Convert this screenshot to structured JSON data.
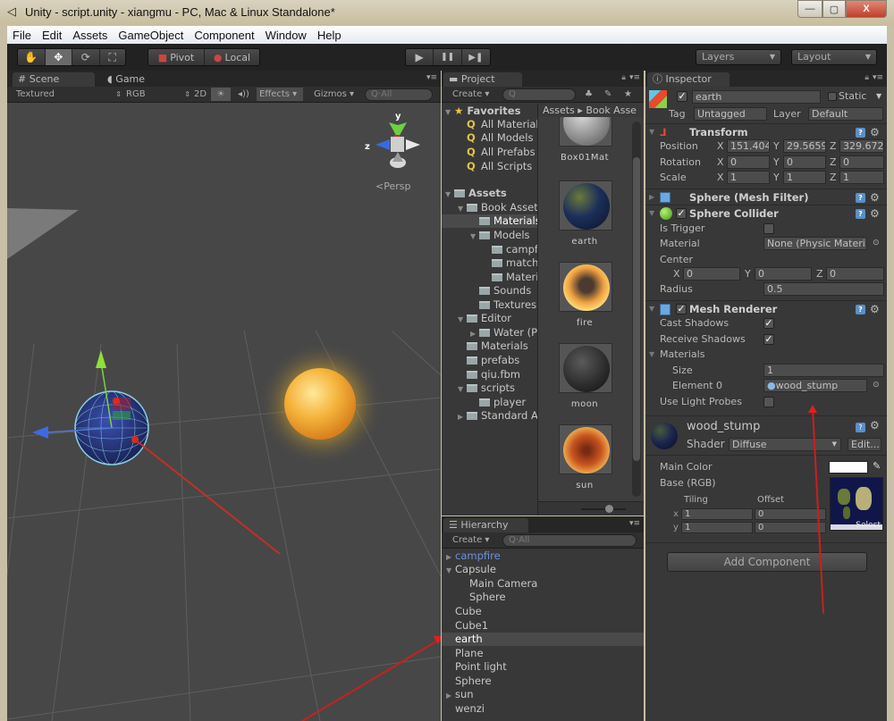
{
  "window": {
    "title": "Unity - script.unity - xiangmu - PC, Mac & Linux Standalone*",
    "controls": {
      "minimize": "—",
      "maximize": "▢",
      "close": "X"
    }
  },
  "menu": [
    "File",
    "Edit",
    "Assets",
    "GameObject",
    "Component",
    "Window",
    "Help"
  ],
  "toolbar": {
    "transform_tools": [
      {
        "name": "hand-tool",
        "glyph": "✋"
      },
      {
        "name": "move-tool",
        "glyph": "✥"
      },
      {
        "name": "rotate-tool",
        "glyph": "⟳"
      },
      {
        "name": "scale-tool",
        "glyph": "⛶"
      }
    ],
    "pivot_label": "Pivot",
    "local_label": "Local",
    "play_glyph": "▶",
    "pause_glyph": "❚❚",
    "step_glyph": "▶❚",
    "layers_label": "Layers",
    "layout_label": "Layout"
  },
  "scene_panel": {
    "tabs": [
      "Scene",
      "Game"
    ],
    "render_mode": "Textured",
    "color_mode": "RGB",
    "btn_2d": "2D",
    "effects_label": "Effects",
    "gizmos_label": "Gizmos",
    "search_placeholder": "All",
    "gizmo_y": "y",
    "gizmo_z": "z",
    "persp_label": "Persp"
  },
  "project_panel": {
    "tab": "Project",
    "create_label": "Create",
    "breadcrumb": "Assets ▸ Book Asse",
    "favorites_label": "Favorites",
    "favorites": [
      "All Material",
      "All Models",
      "All Prefabs",
      "All Scripts"
    ],
    "assets_label": "Assets",
    "tree": [
      {
        "label": "Book Asset",
        "depth": 1,
        "expanded": true
      },
      {
        "label": "Materials",
        "depth": 2,
        "selected": true
      },
      {
        "label": "Models",
        "depth": 2,
        "expanded": true
      },
      {
        "label": "campf",
        "depth": 3
      },
      {
        "label": "match",
        "depth": 3
      },
      {
        "label": "Materi",
        "depth": 3
      },
      {
        "label": "Sounds",
        "depth": 2
      },
      {
        "label": "Textures",
        "depth": 2
      },
      {
        "label": "Editor",
        "depth": 1,
        "expanded": true
      },
      {
        "label": "Water (P",
        "depth": 2,
        "collapsed": true
      },
      {
        "label": "Materials",
        "depth": 1
      },
      {
        "label": "prefabs",
        "depth": 1
      },
      {
        "label": "qiu.fbm",
        "depth": 1
      },
      {
        "label": "scripts",
        "depth": 1,
        "expanded": true
      },
      {
        "label": "player",
        "depth": 2
      },
      {
        "label": "Standard A",
        "depth": 1,
        "collapsed": true
      }
    ],
    "materials": [
      {
        "label": "Box01Mat",
        "color": "#9a9a9a"
      },
      {
        "label": "earth",
        "color": "#1c2f5a"
      },
      {
        "label": "fire",
        "color": "#e8902a"
      },
      {
        "label": "moon",
        "color": "#2a2a2a"
      },
      {
        "label": "sun",
        "color": "#c8541e"
      }
    ]
  },
  "hierarchy_panel": {
    "tab": "Hierarchy",
    "create_label": "Create",
    "search_placeholder": "All",
    "items": [
      {
        "label": "campfire",
        "depth": 0,
        "arrow": "▶",
        "prefab": true
      },
      {
        "label": "Capsule",
        "depth": 0,
        "arrow": "▼"
      },
      {
        "label": "Main Camera",
        "depth": 1
      },
      {
        "label": "Sphere",
        "depth": 1
      },
      {
        "label": "Cube",
        "depth": 0
      },
      {
        "label": "Cube1",
        "depth": 0
      },
      {
        "label": "earth",
        "depth": 0,
        "selected": true
      },
      {
        "label": "Plane",
        "depth": 0
      },
      {
        "label": "Point light",
        "depth": 0
      },
      {
        "label": "Sphere",
        "depth": 0
      },
      {
        "label": "sun",
        "depth": 0,
        "arrow": "▶"
      },
      {
        "label": "wenzi",
        "depth": 0
      }
    ]
  },
  "inspector": {
    "tab": "Inspector",
    "object_name": "earth",
    "active": true,
    "static_label": "Static",
    "tag_label": "Tag",
    "tag_value": "Untagged",
    "layer_label": "Layer",
    "layer_value": "Default",
    "transform": {
      "title": "Transform",
      "position": {
        "label": "Position",
        "x": "151.404",
        "y": "29.5659",
        "z": "329.672"
      },
      "rotation": {
        "label": "Rotation",
        "x": "0",
        "y": "0",
        "z": "0"
      },
      "scale": {
        "label": "Scale",
        "x": "1",
        "y": "1",
        "z": "1"
      }
    },
    "mesh_filter": {
      "title": "Sphere (Mesh Filter)"
    },
    "sphere_collider": {
      "title": "Sphere Collider",
      "is_trigger_label": "Is Trigger",
      "is_trigger": false,
      "material_label": "Material",
      "material_value": "None (Physic Materi",
      "center_label": "Center",
      "center": {
        "x": "0",
        "y": "0",
        "z": "0"
      },
      "radius_label": "Radius",
      "radius_value": "0.5"
    },
    "mesh_renderer": {
      "title": "Mesh Renderer",
      "cast_shadows_label": "Cast Shadows",
      "cast_shadows": true,
      "receive_shadows_label": "Receive Shadows",
      "receive_shadows": true,
      "materials_label": "Materials",
      "size_label": "Size",
      "size_value": "1",
      "element0_label": "Element 0",
      "element0_value": "wood_stump",
      "light_probes_label": "Use Light Probes",
      "light_probes": false
    },
    "material": {
      "name": "wood_stump",
      "shader_label": "Shader",
      "shader_value": "Diffuse",
      "edit_label": "Edit...",
      "main_color_label": "Main Color",
      "main_color": "#ffffff",
      "base_label": "Base (RGB)",
      "tiling_label": "Tiling",
      "offset_label": "Offset",
      "x_label": "x",
      "y_label": "y",
      "tiling_x": "1",
      "tiling_y": "1",
      "offset_x": "0",
      "offset_y": "0",
      "select_label": "Select"
    },
    "add_component_label": "Add Component"
  },
  "colors": {
    "annotation_red": "#d21f1f",
    "prefab_blue": "#6f8fe0",
    "favorite_yellow": "#e0c44a"
  }
}
